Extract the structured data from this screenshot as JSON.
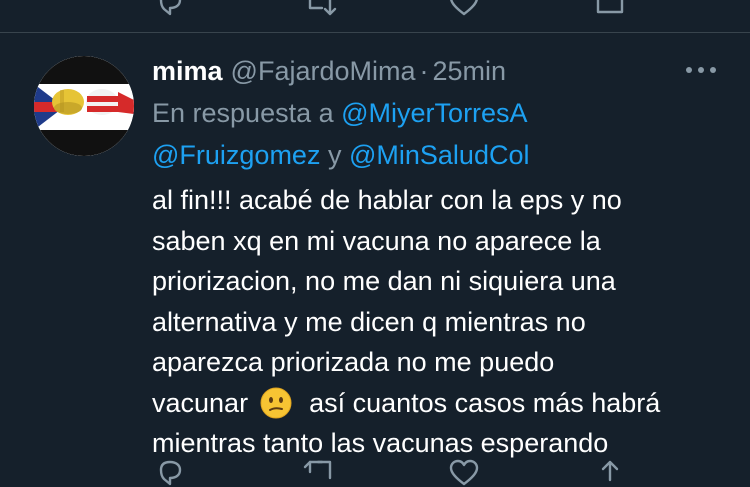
{
  "previous_tweet": {
    "like_count": "2"
  },
  "tweet": {
    "display_name": "mima",
    "handle": "@FajardoMima",
    "separator": "·",
    "timestamp": "25min",
    "reply_prefix": "En respuesta a",
    "mentions": [
      "@MiyerTorresA",
      "@Fruizgomez",
      "@MinSaludCol"
    ],
    "mention_conjunction": "y",
    "text_lines": [
      "al fin!!! acabé de hablar con la eps y no",
      "saben xq en mi vacuna no aparece la",
      "priorizacion, no me dan ni siquiera una",
      "alternativa y me dicen q mientras no",
      "aparezca priorizada no me puedo"
    ],
    "text_line6_before": "vacunar",
    "emoji": "confused-face",
    "text_line6_after": "así cuantos casos más habrá",
    "text_line7": "mientras tanto las vacunas esperando"
  },
  "icons": {
    "more": "more-horizontal-icon",
    "reply": "reply-icon",
    "retweet": "retweet-icon",
    "like": "heart-icon",
    "share": "share-icon"
  },
  "colors": {
    "background": "#15202b",
    "muted": "#8899a6",
    "accent": "#1da1f2",
    "divider": "#38444d"
  }
}
